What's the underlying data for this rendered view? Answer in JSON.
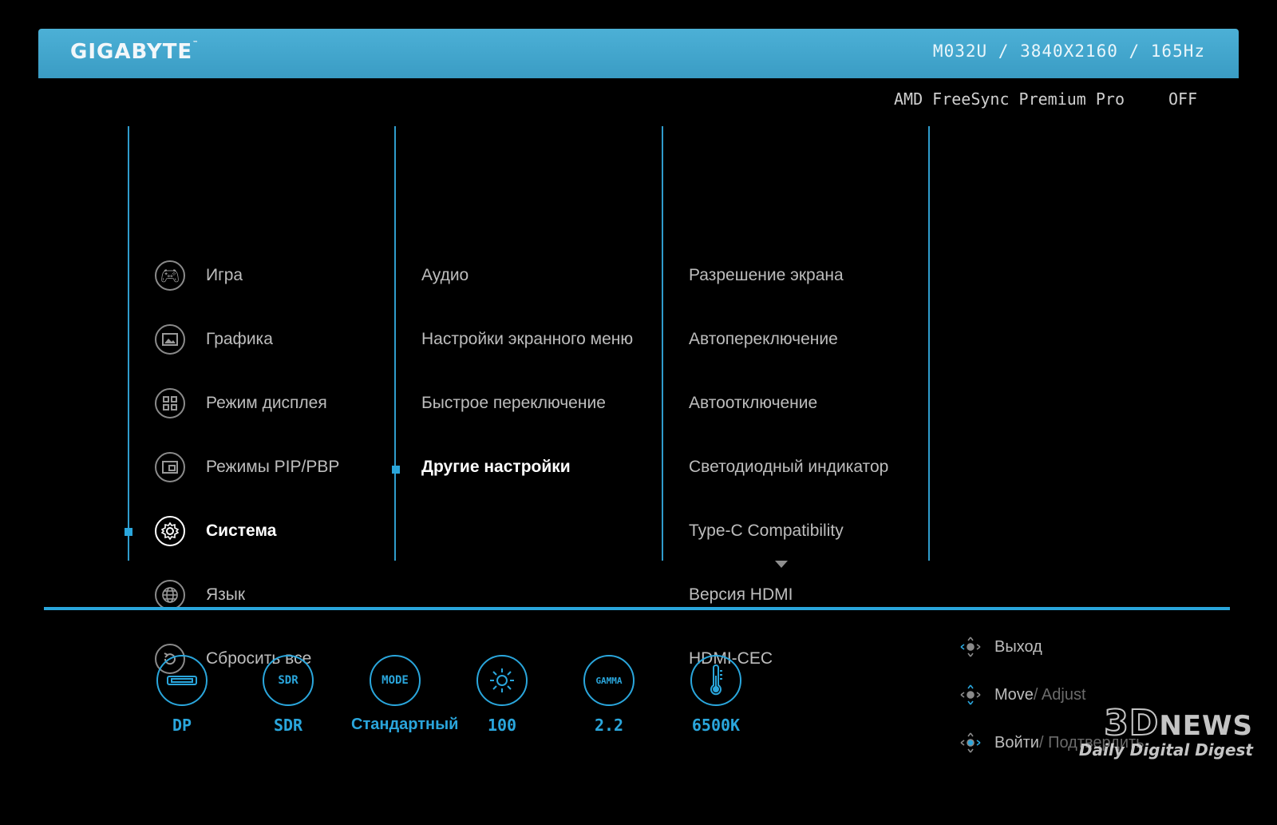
{
  "header": {
    "brand": "GIGABYTE",
    "brand_tm": "™",
    "model_info": "M032U / 3840X2160 / 165Hz"
  },
  "status": {
    "freesync_label": "AMD FreeSync Premium Pro",
    "freesync_value": "OFF"
  },
  "menu": {
    "main": [
      {
        "label": "Игра",
        "icon": "gamepad-icon"
      },
      {
        "label": "Графика",
        "icon": "picture-icon"
      },
      {
        "label": "Режим дисплея",
        "icon": "grid-icon"
      },
      {
        "label": "Режимы PIP/PBP",
        "icon": "pip-icon"
      },
      {
        "label": "Система",
        "icon": "gear-icon",
        "selected": true
      },
      {
        "label": "Язык",
        "icon": "globe-icon"
      },
      {
        "label": "Сбросить все",
        "icon": "reset-icon"
      }
    ],
    "sub": [
      {
        "label": "Аудио"
      },
      {
        "label": "Настройки экранного меню"
      },
      {
        "label": "Быстрое переключение"
      },
      {
        "label": "Другие настройки",
        "selected": true
      }
    ],
    "options": [
      {
        "label": "Разрешение экрана"
      },
      {
        "label": "Автопереключение"
      },
      {
        "label": "Автоотключение"
      },
      {
        "label": "Светодиодный индикатор"
      },
      {
        "label": "Type-C Compatibility"
      },
      {
        "label": "Версия HDMI"
      },
      {
        "label": "HDMI-CEC"
      }
    ]
  },
  "quick_status": [
    {
      "icon": "input-port-icon",
      "icon_text": "",
      "label": "DP"
    },
    {
      "icon": "sdr-icon",
      "icon_text": "SDR",
      "label": "SDR"
    },
    {
      "icon": "mode-icon",
      "icon_text": "MODE",
      "label": "Стандартный"
    },
    {
      "icon": "brightness-icon",
      "icon_text": "☼",
      "label": "100"
    },
    {
      "icon": "gamma-icon",
      "icon_text": "GAMMA",
      "label": "2.2"
    },
    {
      "icon": "color-temp-icon",
      "icon_text": "🌡",
      "label": "6500K"
    }
  ],
  "hints": [
    {
      "main": "Выход",
      "sub": ""
    },
    {
      "main": "Move",
      "sub": " / Adjust"
    },
    {
      "main": "Войти",
      "sub": " / Подтвердить"
    }
  ],
  "watermark": {
    "logo_num": "3D",
    "logo_text": "NEWS",
    "tagline": "Daily Digital Digest"
  },
  "colors": {
    "accent": "#2aa6dc",
    "header": "#44a9d0",
    "text": "#bdbdbd",
    "background": "#000000"
  }
}
